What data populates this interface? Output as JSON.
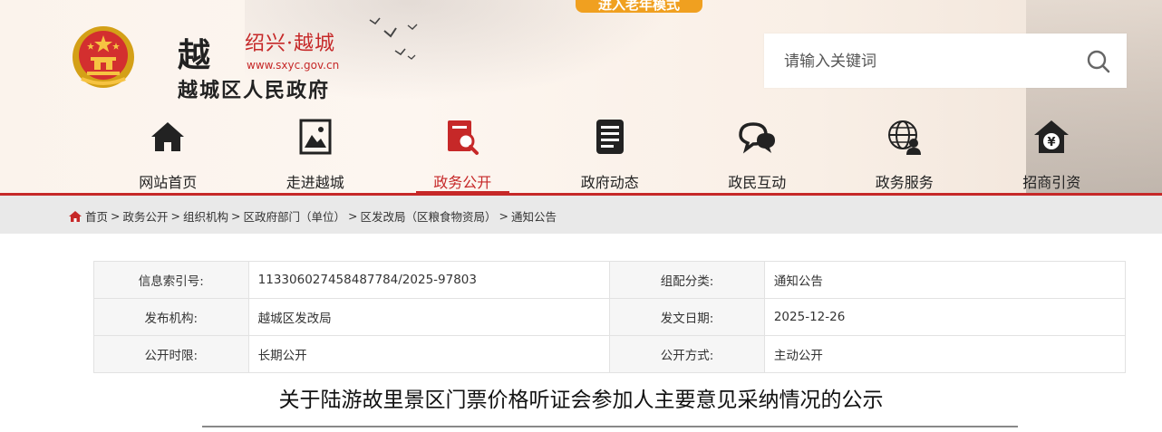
{
  "header": {
    "elder_mode_label": "进入老年模式",
    "logo": {
      "glyph": "越",
      "city_name": "绍兴·越城",
      "url": "www.sxyc.gov.cn",
      "gov_name": "越城区人民政府"
    },
    "search": {
      "placeholder": "请输入关键词"
    }
  },
  "nav": {
    "items": [
      {
        "label": "网站首页",
        "icon": "house-icon"
      },
      {
        "label": "走进越城",
        "icon": "picture-icon"
      },
      {
        "label": "政务公开",
        "icon": "document-search-icon"
      },
      {
        "label": "政府动态",
        "icon": "news-icon"
      },
      {
        "label": "政民互动",
        "icon": "chat-icon"
      },
      {
        "label": "政务服务",
        "icon": "globe-person-icon"
      },
      {
        "label": "招商引资",
        "icon": "yuan-house-icon"
      }
    ],
    "active_index": 2
  },
  "breadcrumb": [
    "首页",
    "政务公开",
    "组织机构",
    "区政府部门（单位）",
    "区发改局（区粮食物资局）",
    "通知公告"
  ],
  "info": {
    "rows": [
      {
        "k1": "信息索引号:",
        "v1": "113306027458487784/2025-97803",
        "k2": "组配分类:",
        "v2": "通知公告"
      },
      {
        "k1": "发布机构:",
        "v1": "越城区发改局",
        "k2": "发文日期:",
        "v2": "2025-12-26"
      },
      {
        "k1": "公开时限:",
        "v1": "长期公开",
        "k2": "公开方式:",
        "v2": "主动公开"
      }
    ]
  },
  "document": {
    "title": "关于陆游故里景区门票价格听证会参加人主要意见采纳情况的公示"
  },
  "colors": {
    "accent": "#c62828",
    "elder_button": "#f0a020"
  }
}
